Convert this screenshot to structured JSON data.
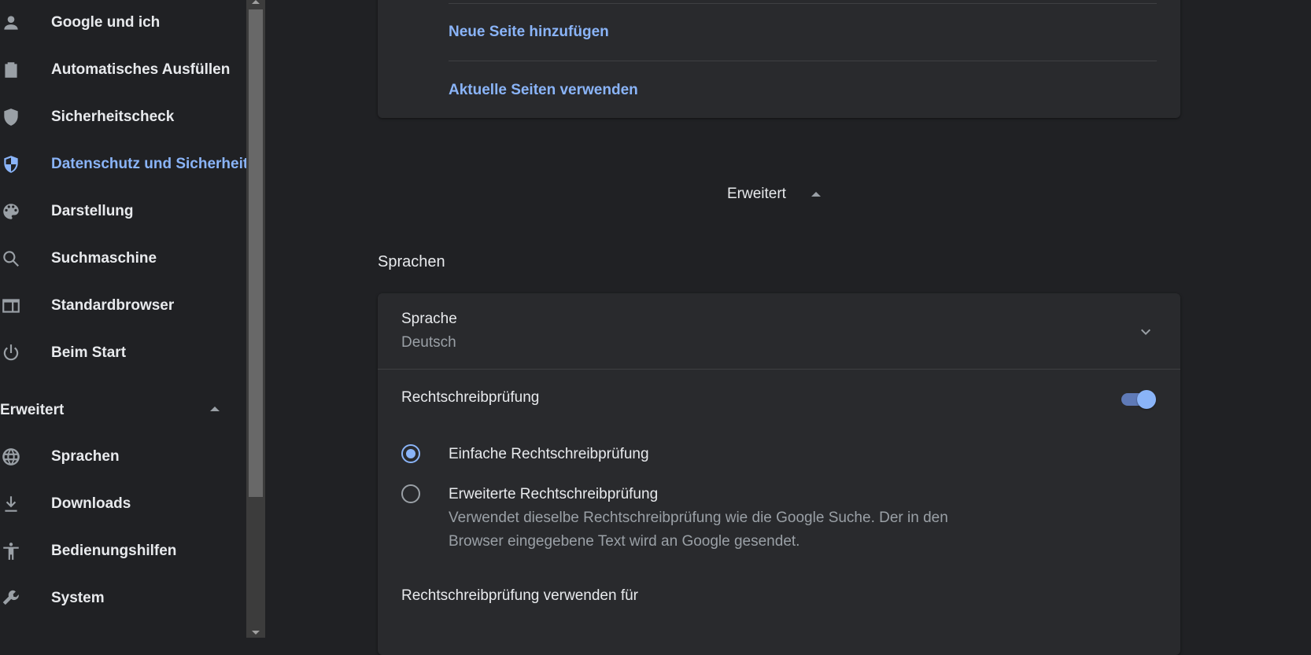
{
  "sidebar": {
    "items": [
      {
        "label": "Google und ich",
        "icon": "person-icon"
      },
      {
        "label": "Automatisches Ausfüllen",
        "icon": "clipboard-icon"
      },
      {
        "label": "Sicherheitscheck",
        "icon": "shield-check-icon"
      },
      {
        "label": "Datenschutz und Sicherheit",
        "icon": "shield-half-icon",
        "active": true
      },
      {
        "label": "Darstellung",
        "icon": "palette-icon"
      },
      {
        "label": "Suchmaschine",
        "icon": "search-icon"
      },
      {
        "label": "Standardbrowser",
        "icon": "browser-window-icon"
      },
      {
        "label": "Beim Start",
        "icon": "power-icon"
      }
    ],
    "advanced_label": "Erweitert",
    "advanced_items": [
      {
        "label": "Sprachen",
        "icon": "globe-icon"
      },
      {
        "label": "Downloads",
        "icon": "download-icon"
      },
      {
        "label": "Bedienungshilfen",
        "icon": "accessibility-icon"
      },
      {
        "label": "System",
        "icon": "wrench-icon"
      }
    ]
  },
  "startup": {
    "add_page_link": "Neue Seite hinzufügen",
    "use_current_link": "Aktuelle Seiten verwenden"
  },
  "main": {
    "advanced_toggle_label": "Erweitert",
    "languages_section_title": "Sprachen",
    "language": {
      "label": "Sprache",
      "value": "Deutsch"
    },
    "spellcheck": {
      "label": "Rechtschreibprüfung",
      "enabled": true,
      "basic_label": "Einfache Rechtschreibprüfung",
      "enhanced_label": "Erweiterte Rechtschreibprüfung",
      "enhanced_desc_line1": "Verwendet dieselbe Rechtschreibprüfung wie die Google Suche. Der in den",
      "enhanced_desc_line2": "Browser eingegebene Text wird an Google gesendet.",
      "use_for_label": "Rechtschreibprüfung verwenden für"
    }
  },
  "colors": {
    "background": "#202124",
    "card": "#292a2d",
    "accent": "#8ab4f8",
    "text_primary": "#e8eaed",
    "text_secondary": "#9aa0a6"
  }
}
